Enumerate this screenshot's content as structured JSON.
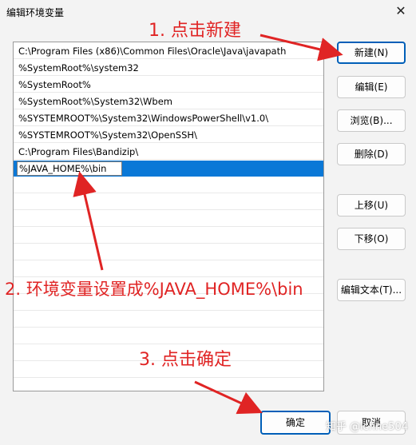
{
  "window": {
    "title": "编辑环境变量",
    "close_glyph": "✕"
  },
  "paths": [
    "C:\\Program Files (x86)\\Common Files\\Oracle\\Java\\javapath",
    "%SystemRoot%\\system32",
    "%SystemRoot%",
    "%SystemRoot%\\System32\\Wbem",
    "%SYSTEMROOT%\\System32\\WindowsPowerShell\\v1.0\\",
    "%SYSTEMROOT%\\System32\\OpenSSH\\",
    "C:\\Program Files\\Bandizip\\"
  ],
  "editing_value": "%JAVA_HOME%\\bin",
  "buttons": {
    "new": "新建(N)",
    "edit": "编辑(E)",
    "browse": "浏览(B)...",
    "delete": "删除(D)",
    "move_up": "上移(U)",
    "move_down": "下移(O)",
    "edit_text": "编辑文本(T)...",
    "ok": "确定",
    "cancel": "取消"
  },
  "annotations": {
    "step1": "1. 点击新建",
    "step2": "2. 环境变量设置成%JAVA_HOME%\\bin",
    "step3": "3. 点击确定"
  },
  "watermark": "知乎 @ichne504",
  "colors": {
    "selection": "#0a78d7",
    "annotation": "#e02424",
    "default_border": "#005fb8"
  }
}
